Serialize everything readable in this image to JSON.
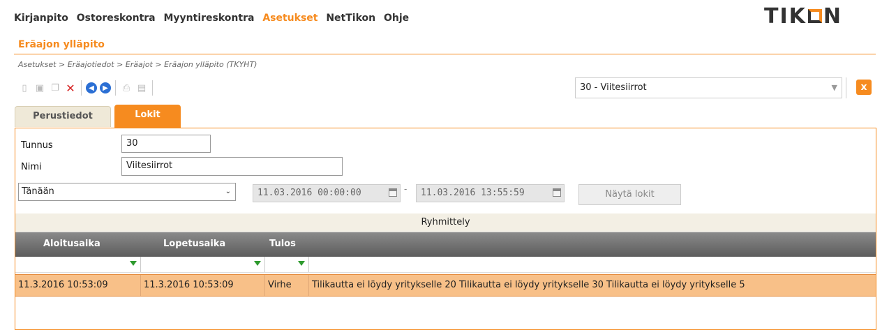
{
  "menu": {
    "items": [
      "Kirjanpito",
      "Ostoreskontra",
      "Myyntireskontra",
      "Asetukset",
      "NetTikon",
      "Ohje"
    ]
  },
  "logo": {
    "left": "TIK",
    "right": "N"
  },
  "page": {
    "title": "Eräajon ylläpito",
    "breadcrumb": "Asetukset > Eräajotiedot > Eräajot > Eräajon ylläpito  (TKYHT)"
  },
  "toolbar": {
    "icons": [
      "new-document-icon",
      "save-icon",
      "copy-icon",
      "delete-icon",
      "previous-icon",
      "next-icon",
      "print-icon",
      "preview-icon"
    ]
  },
  "job_select": {
    "value": "30 - Viitesiirrot"
  },
  "close_label": "x",
  "tabs": [
    {
      "label": "Perustiedot"
    },
    {
      "label": "Lokit"
    }
  ],
  "form": {
    "tunnus_label": "Tunnus",
    "tunnus_value": "30",
    "nimi_label": "Nimi",
    "nimi_value": "Viitesiirrot",
    "period_value": "Tänään",
    "start_datetime": "11.03.2016 00:00:00",
    "date_separator": "-",
    "end_datetime": "11.03.2016 13:55:59",
    "show_logs_label": "Näytä lokit"
  },
  "grid": {
    "grouping_label": "Ryhmittely",
    "columns": [
      "Aloitusaika",
      "Lopetusaika",
      "Tulos"
    ],
    "rows": [
      {
        "start": "11.3.2016 10:53:09",
        "end": "11.3.2016 10:53:09",
        "result": "Virhe",
        "message": "Tilikautta ei löydy yritykselle 20  Tilikautta ei löydy yritykselle 30  Tilikautta ei löydy yritykselle 5"
      }
    ]
  },
  "colors": {
    "accent": "#f68b1f",
    "row_highlight": "#f8c088",
    "header_gray": "#6f6f6f"
  }
}
